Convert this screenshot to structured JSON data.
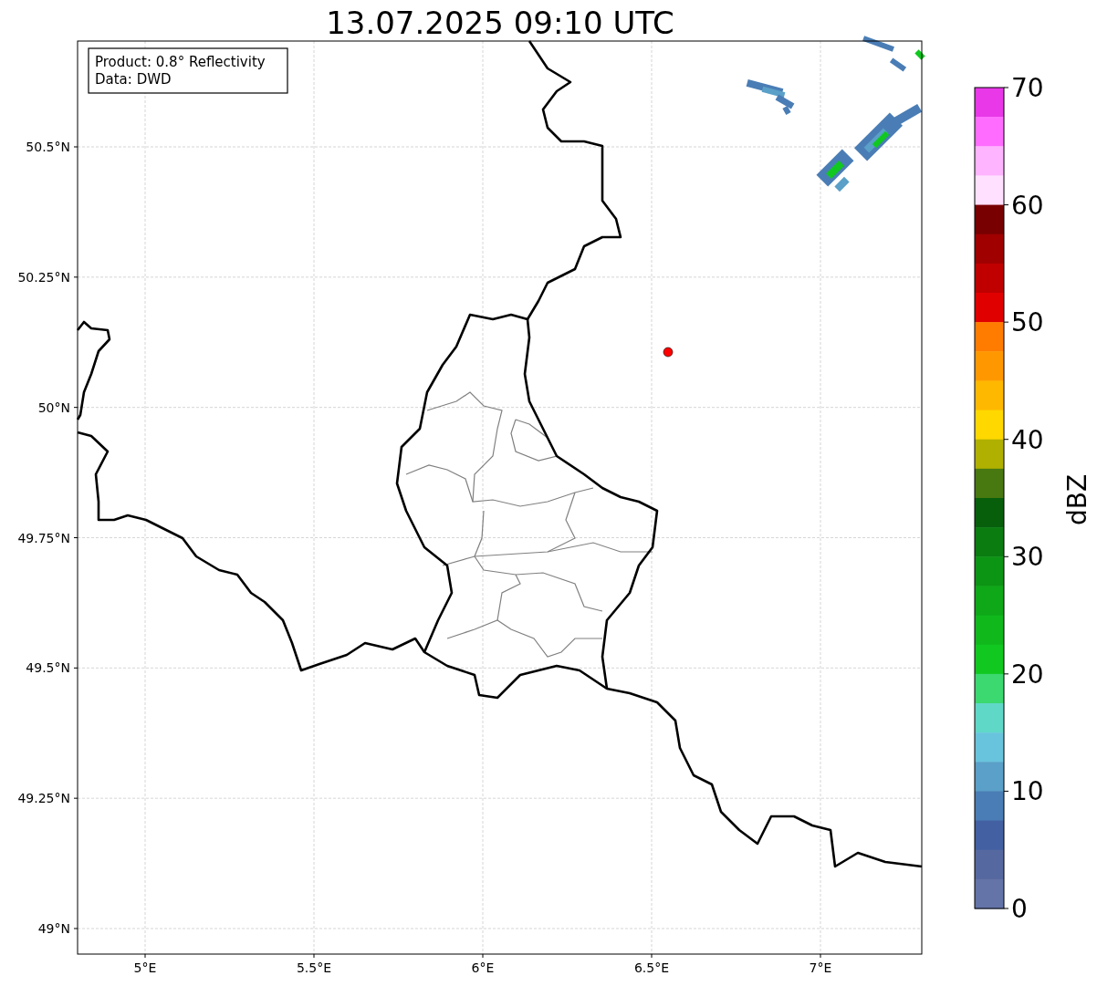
{
  "title": "13.07.2025 09:10 UTC",
  "info_box": {
    "lines": [
      "Product: 0.8° Reflectivity",
      "Data: DWD"
    ]
  },
  "map": {
    "xtick_labels": [
      "5°E",
      "5.5°E",
      "6°E",
      "6.5°E",
      "7°E"
    ],
    "ytick_labels": [
      "50.5°N",
      "50.25°N",
      "50°N",
      "49.75°N",
      "49.5°N",
      "49.25°N",
      "49°N"
    ]
  },
  "colorbar": {
    "label": "dBZ",
    "ticks": [
      "70",
      "60",
      "50",
      "40",
      "30",
      "20",
      "10",
      "0"
    ],
    "bands": [
      {
        "color": "#e838e8"
      },
      {
        "color": "#ff6cff"
      },
      {
        "color": "#ffb4ff"
      },
      {
        "color": "#ffe0ff"
      },
      {
        "color": "#780000"
      },
      {
        "color": "#a00000"
      },
      {
        "color": "#c00000"
      },
      {
        "color": "#e00000"
      },
      {
        "color": "#ff7c00"
      },
      {
        "color": "#ff9800"
      },
      {
        "color": "#ffb800"
      },
      {
        "color": "#ffd800"
      },
      {
        "color": "#b0b000"
      },
      {
        "color": "#487810"
      },
      {
        "color": "#075f0c"
      },
      {
        "color": "#0a7c10"
      },
      {
        "color": "#0c9414"
      },
      {
        "color": "#0ea818"
      },
      {
        "color": "#10b81c"
      },
      {
        "color": "#10c820"
      },
      {
        "color": "#3cd870"
      },
      {
        "color": "#60d8c8"
      },
      {
        "color": "#68c4dc"
      },
      {
        "color": "#5aa0c8"
      },
      {
        "color": "#4a7db5"
      },
      {
        "color": "#4360a3"
      },
      {
        "color": "#5668a0"
      },
      {
        "color": "#6474a8"
      }
    ]
  }
}
